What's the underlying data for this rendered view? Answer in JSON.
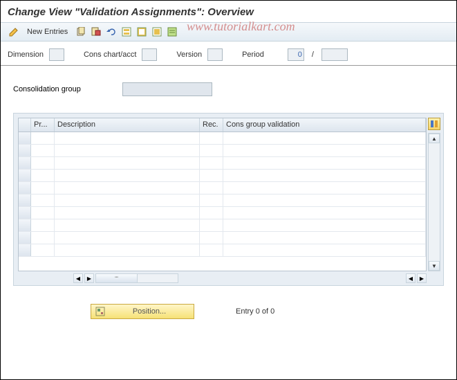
{
  "title": "Change View \"Validation Assignments\": Overview",
  "watermark": "www.tutorialkart.com",
  "toolbar": {
    "new_entries": "New Entries"
  },
  "filters": {
    "dimension_label": "Dimension",
    "cons_chart_label": "Cons chart/acct",
    "version_label": "Version",
    "period_label": "Period",
    "period_value": "0",
    "slash": "/"
  },
  "cons_group": {
    "label": "Consolidation group",
    "value": ""
  },
  "table": {
    "columns": {
      "pr": "Pr...",
      "description": "Description",
      "rec": "Rec.",
      "cgv": "Cons group validation"
    },
    "rows": [
      "",
      "",
      "",
      "",
      "",
      "",
      "",
      "",
      "",
      ""
    ]
  },
  "footer": {
    "position_btn": "Position...",
    "entry_text": "Entry 0 of 0"
  }
}
